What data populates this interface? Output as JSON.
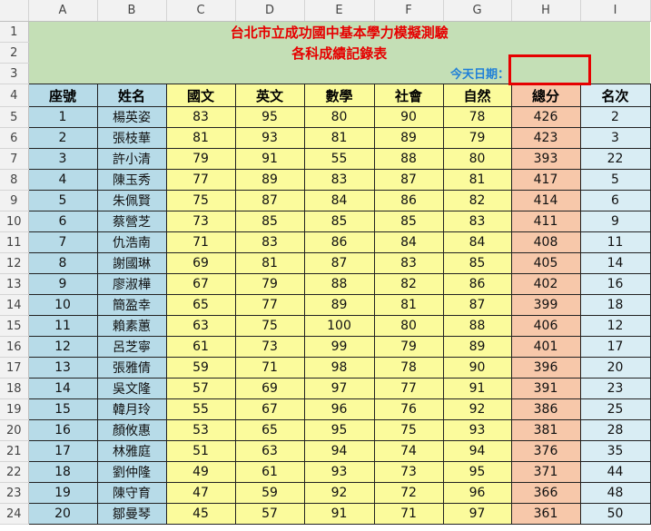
{
  "columns": [
    "A",
    "B",
    "C",
    "D",
    "E",
    "F",
    "G",
    "H",
    "I"
  ],
  "row_numbers": [
    "1",
    "2",
    "3",
    "4",
    "5",
    "6",
    "7",
    "8",
    "9",
    "10",
    "11",
    "12",
    "13",
    "14",
    "15",
    "16",
    "17",
    "18",
    "19",
    "20",
    "21",
    "22",
    "23",
    "24"
  ],
  "title_line1": "台北市立成功國中基本學力模擬測驗",
  "title_line2": "各科成績記錄表",
  "date_label": "今天日期：",
  "headers": [
    "座號",
    "姓名",
    "國文",
    "英文",
    "數學",
    "社會",
    "自然",
    "總分",
    "名次"
  ],
  "rows": [
    [
      "1",
      "楊英姿",
      "83",
      "95",
      "80",
      "90",
      "78",
      "426",
      "2"
    ],
    [
      "2",
      "張枝華",
      "81",
      "93",
      "81",
      "89",
      "79",
      "423",
      "3"
    ],
    [
      "3",
      "許小清",
      "79",
      "91",
      "55",
      "88",
      "80",
      "393",
      "22"
    ],
    [
      "4",
      "陳玉秀",
      "77",
      "89",
      "83",
      "87",
      "81",
      "417",
      "5"
    ],
    [
      "5",
      "朱佩賢",
      "75",
      "87",
      "84",
      "86",
      "82",
      "414",
      "6"
    ],
    [
      "6",
      "蔡營芝",
      "73",
      "85",
      "85",
      "85",
      "83",
      "411",
      "9"
    ],
    [
      "7",
      "仇浩南",
      "71",
      "83",
      "86",
      "84",
      "84",
      "408",
      "11"
    ],
    [
      "8",
      "謝國琳",
      "69",
      "81",
      "87",
      "83",
      "85",
      "405",
      "14"
    ],
    [
      "9",
      "廖淑樺",
      "67",
      "79",
      "88",
      "82",
      "86",
      "402",
      "16"
    ],
    [
      "10",
      "簡盈幸",
      "65",
      "77",
      "89",
      "81",
      "87",
      "399",
      "18"
    ],
    [
      "11",
      "賴素蕙",
      "63",
      "75",
      "100",
      "80",
      "88",
      "406",
      "12"
    ],
    [
      "12",
      "呂芝寧",
      "61",
      "73",
      "99",
      "79",
      "89",
      "401",
      "17"
    ],
    [
      "13",
      "張雅倩",
      "59",
      "71",
      "98",
      "78",
      "90",
      "396",
      "20"
    ],
    [
      "14",
      "吳文隆",
      "57",
      "69",
      "97",
      "77",
      "91",
      "391",
      "23"
    ],
    [
      "15",
      "韓月玲",
      "55",
      "67",
      "96",
      "76",
      "92",
      "386",
      "25"
    ],
    [
      "16",
      "顏攸惠",
      "53",
      "65",
      "95",
      "75",
      "93",
      "381",
      "28"
    ],
    [
      "17",
      "林雅庭",
      "51",
      "63",
      "94",
      "74",
      "94",
      "376",
      "35"
    ],
    [
      "18",
      "劉仲隆",
      "49",
      "61",
      "93",
      "73",
      "95",
      "371",
      "44"
    ],
    [
      "19",
      "陳守育",
      "47",
      "59",
      "92",
      "72",
      "96",
      "366",
      "48"
    ],
    [
      "20",
      "鄒曼琴",
      "45",
      "57",
      "91",
      "71",
      "97",
      "361",
      "50"
    ]
  ],
  "colors": {
    "blue": "#b7dbe8",
    "yellow": "#fbfb9c",
    "orange": "#f7c8aa",
    "light_blue": "#d9edf4",
    "title_bg": "#c4dfb6",
    "title_text": "#e60000",
    "date_text": "#1f7fd8",
    "highlight_box": "#e60000"
  }
}
